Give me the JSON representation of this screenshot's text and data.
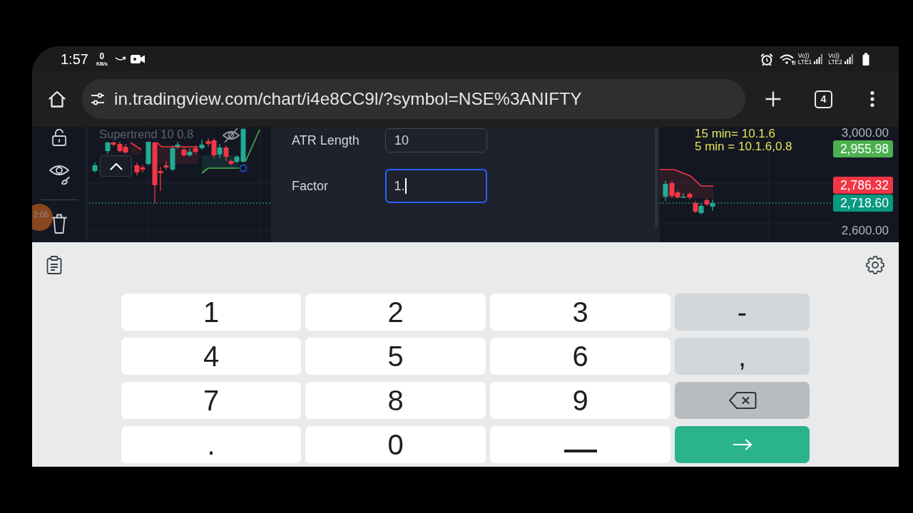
{
  "status_bar": {
    "time": "1:57",
    "data_speed": {
      "value": "0",
      "unit": "KB/s"
    },
    "sims": [
      {
        "voice": "Vo))",
        "network": "LTE1"
      },
      {
        "voice": "Vo))",
        "network": "LTE2"
      }
    ]
  },
  "browser": {
    "url": "in.tradingview.com/chart/i4e8CC9l/?symbol=NSE%3ANIFTY",
    "tab_count": "4"
  },
  "chart_toolbar": {
    "time_label": "2:05"
  },
  "chart_left": {
    "legend": "Supertrend 10 0.8"
  },
  "settings": {
    "fields": [
      {
        "label": "ATR Length",
        "value": "10",
        "focused": false
      },
      {
        "label": "Factor",
        "value": "1.",
        "focused": true
      }
    ]
  },
  "chart_right": {
    "notes": [
      "15 min= 10.1.6",
      "5 min = 10.1.6,0.8"
    ],
    "price_scale": [
      {
        "kind": "tick",
        "text": "3,000.00"
      },
      {
        "kind": "tag",
        "text": "2,955.98",
        "color": "#4caf50"
      },
      {
        "kind": "tag",
        "text": "2,786.32",
        "color": "#f23645"
      },
      {
        "kind": "tag",
        "text": "2,718.60",
        "color": "#089981"
      },
      {
        "kind": "tick",
        "text": "2,600.00"
      }
    ]
  },
  "keyboard": {
    "rows": [
      [
        {
          "kind": "char",
          "label": "1"
        },
        {
          "kind": "char",
          "label": "2"
        },
        {
          "kind": "char",
          "label": "3"
        },
        {
          "kind": "symbol",
          "label": "-"
        }
      ],
      [
        {
          "kind": "char",
          "label": "4"
        },
        {
          "kind": "char",
          "label": "5"
        },
        {
          "kind": "char",
          "label": "6"
        },
        {
          "kind": "symbol",
          "label": ","
        }
      ],
      [
        {
          "kind": "char",
          "label": "7"
        },
        {
          "kind": "char",
          "label": "8"
        },
        {
          "kind": "char",
          "label": "9"
        },
        {
          "kind": "backspace"
        }
      ],
      [
        {
          "kind": "char",
          "label": "."
        },
        {
          "kind": "char",
          "label": "0"
        },
        {
          "kind": "space"
        },
        {
          "kind": "enter"
        }
      ]
    ]
  }
}
